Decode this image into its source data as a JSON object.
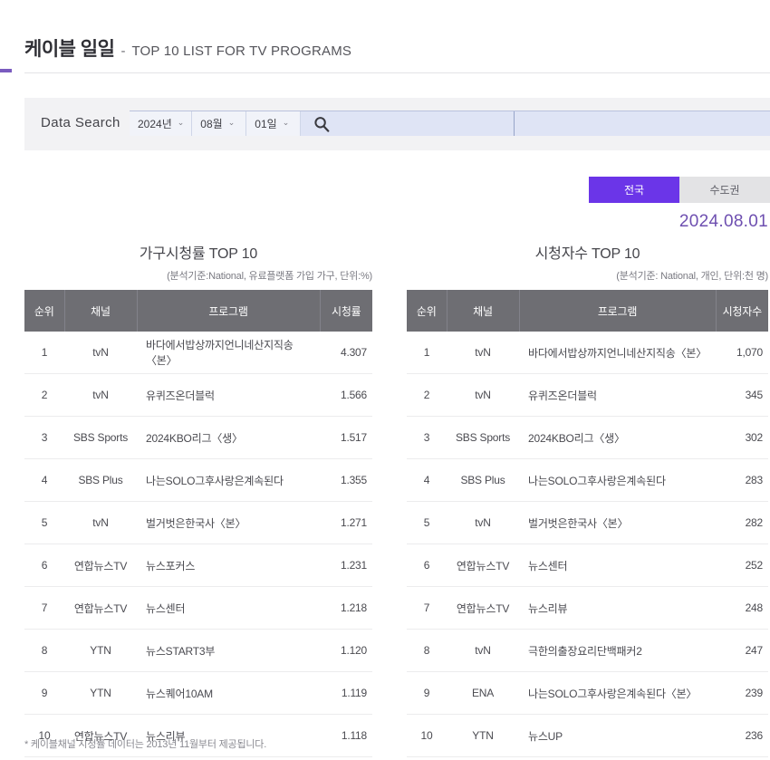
{
  "header": {
    "title_ko": "케이블 일일",
    "dash": "-",
    "title_en": "TOP 10 LIST FOR TV PROGRAMS"
  },
  "search": {
    "label": "Data Search",
    "year": "2024년",
    "month": "08월",
    "day": "01일",
    "caret": "⌄",
    "search_icon": "search-icon",
    "keyword_value": "",
    "keyword_placeholder": "",
    "keyword2_value": "",
    "keyword2_placeholder": ""
  },
  "region_tabs": {
    "active_label": "전국",
    "inactive_label": "수도권",
    "active_color": "#6b35e8",
    "inactive_color": "#e3e3e5"
  },
  "date_stamp": "2024.08.01",
  "accent_color": "#6e4fb0",
  "tables": [
    {
      "title": "가구시청률 TOP 10",
      "subtitle": "(분석기준:National, 유료플랫폼 가입 가구, 단위:%)",
      "columns": [
        "순위",
        "채널",
        "프로그램",
        "시청률"
      ],
      "rows": [
        [
          "1",
          "tvN",
          "바다에서밥상까지언니네산지직송〈본〉",
          "4.307"
        ],
        [
          "2",
          "tvN",
          "유퀴즈온더블럭",
          "1.566"
        ],
        [
          "3",
          "SBS Sports",
          "2024KBO리그〈생〉",
          "1.517"
        ],
        [
          "4",
          "SBS Plus",
          "나는SOLO그후사랑은계속된다",
          "1.355"
        ],
        [
          "5",
          "tvN",
          "벌거벗은한국사〈본〉",
          "1.271"
        ],
        [
          "6",
          "연합뉴스TV",
          "뉴스포커스",
          "1.231"
        ],
        [
          "7",
          "연합뉴스TV",
          "뉴스센터",
          "1.218"
        ],
        [
          "8",
          "YTN",
          "뉴스START3부",
          "1.120"
        ],
        [
          "9",
          "YTN",
          "뉴스퀘어10AM",
          "1.119"
        ],
        [
          "10",
          "연합뉴스TV",
          "뉴스리뷰",
          "1.118"
        ]
      ]
    },
    {
      "title": "시청자수 TOP 10",
      "subtitle": "(분석기준: National, 개인, 단위:천 명)",
      "columns": [
        "순위",
        "채널",
        "프로그램",
        "시청자수"
      ],
      "rows": [
        [
          "1",
          "tvN",
          "바다에서밥상까지언니네산지직송〈본〉",
          "1,070"
        ],
        [
          "2",
          "tvN",
          "유퀴즈온더블럭",
          "345"
        ],
        [
          "3",
          "SBS Sports",
          "2024KBO리그〈생〉",
          "302"
        ],
        [
          "4",
          "SBS Plus",
          "나는SOLO그후사랑은계속된다",
          "283"
        ],
        [
          "5",
          "tvN",
          "벌거벗은한국사〈본〉",
          "282"
        ],
        [
          "6",
          "연합뉴스TV",
          "뉴스센터",
          "252"
        ],
        [
          "7",
          "연합뉴스TV",
          "뉴스리뷰",
          "248"
        ],
        [
          "8",
          "tvN",
          "극한의출장요리단백패커2",
          "247"
        ],
        [
          "9",
          "ENA",
          "나는SOLO그후사랑은계속된다〈본〉",
          "239"
        ],
        [
          "10",
          "YTN",
          "뉴스UP",
          "236"
        ]
      ]
    }
  ],
  "footnote": "* 케이블채널 시청률 데이터는 2013년 11월부터 제공됩니다."
}
